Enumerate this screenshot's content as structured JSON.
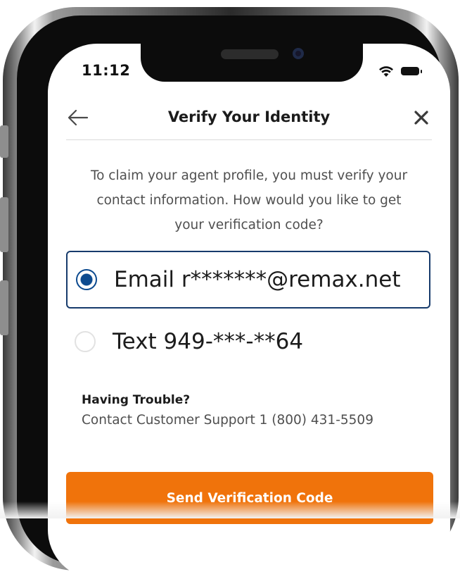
{
  "status_bar": {
    "time": "11:12",
    "icons": [
      "wifi-icon",
      "battery-icon"
    ]
  },
  "header": {
    "back_icon": "arrow-left-icon",
    "title": "Verify Your Identity",
    "close_icon": "close-icon"
  },
  "intro": {
    "line1": "To claim your agent profile, you must verify your",
    "line2": "contact information. How would you like to get",
    "line3": "your verification code?"
  },
  "options": [
    {
      "label": "Email r*******@remax.net",
      "selected": true
    },
    {
      "label": "Text 949-***-**64",
      "selected": false
    }
  ],
  "help": {
    "title": "Having Trouble?",
    "text": "Contact Customer Support 1 (800) 431-5509"
  },
  "action": {
    "send_label": "Send Verification Code"
  },
  "colors": {
    "accent": "#f0730b",
    "selected_border": "#173b6c",
    "radio_selected": "#0c4a8f"
  }
}
